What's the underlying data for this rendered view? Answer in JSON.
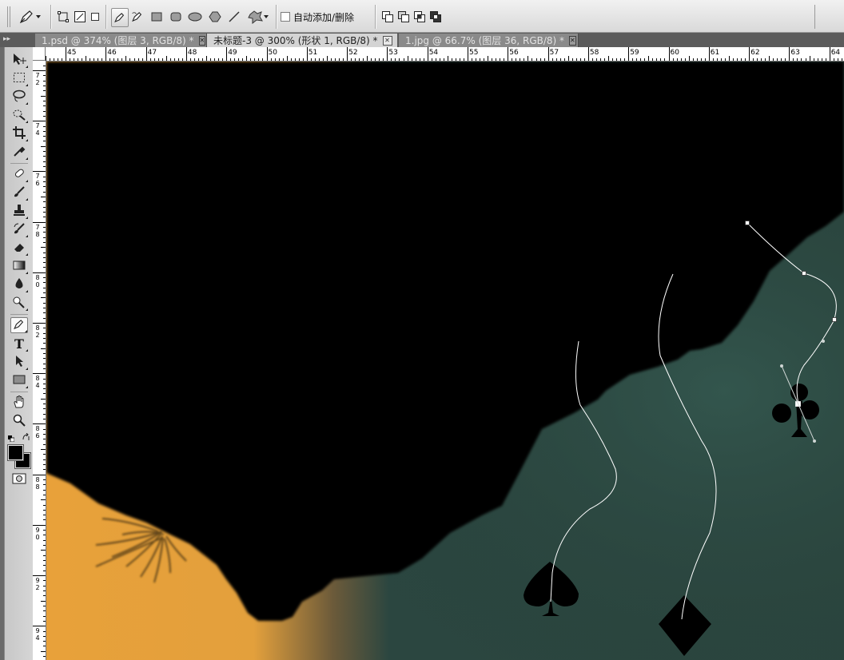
{
  "options_bar": {
    "tool_icon": "pen-icon",
    "mode_buttons": [
      "shape-layers-icon",
      "paths-icon",
      "fill-pixels-icon"
    ],
    "shape_tools": [
      "pen-icon",
      "freeform-pen-icon",
      "rectangle-icon",
      "rounded-rectangle-icon",
      "ellipse-icon",
      "polygon-icon",
      "line-icon",
      "custom-shape-icon"
    ],
    "auto_add_delete_label": "自动添加/删除",
    "auto_add_delete_checked": false,
    "path_ops": [
      "add-to-path-icon",
      "subtract-from-path-icon",
      "intersect-path-icon",
      "exclude-overlap-icon"
    ]
  },
  "tabs": [
    {
      "label": "1.psd @ 374% (图层 3, RGB/8) *",
      "active": false
    },
    {
      "label": "未标题-3 @ 300% (形状 1, RGB/8) *",
      "active": true
    },
    {
      "label": "1.jpg @ 66.7% (图层 36, RGB/8) *",
      "active": false
    }
  ],
  "tools": [
    "move-icon",
    "marquee-icon",
    "lasso-icon",
    "quick-selection-icon",
    "crop-icon",
    "eyedropper-icon",
    "spot-healing-icon",
    "brush-icon",
    "clone-stamp-icon",
    "history-brush-icon",
    "eraser-icon",
    "gradient-icon",
    "blur-icon",
    "dodge-icon",
    "pen-icon",
    "type-icon",
    "path-selection-icon",
    "rectangle-shape-icon",
    "hand-icon",
    "zoom-icon"
  ],
  "active_tool": "pen-icon",
  "colors": {
    "foreground": "#000000",
    "background": "#000000",
    "canvas_dark": "#000000",
    "teal": "#2e4a43",
    "orange": "#e8a13a"
  },
  "rulers": {
    "horizontal": [
      "45",
      "46",
      "47",
      "48",
      "49",
      "50",
      "51",
      "52",
      "53",
      "54",
      "55",
      "56",
      "57",
      "58",
      "59",
      "60",
      "61",
      "62",
      "63",
      "64"
    ],
    "vertical": [
      "72",
      "74",
      "76",
      "78",
      "80",
      "82",
      "84",
      "86",
      "88",
      "90",
      "92",
      "94"
    ]
  }
}
